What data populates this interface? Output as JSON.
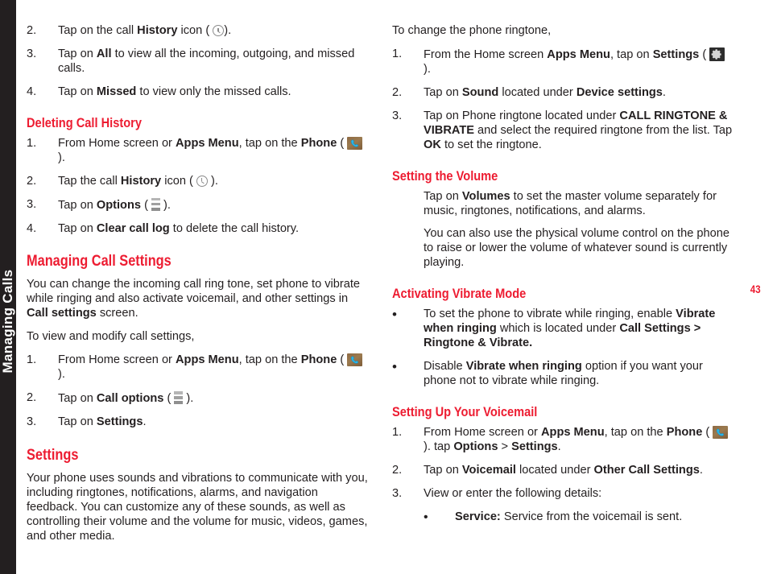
{
  "page": {
    "number": "43",
    "side_tab_label": "Managing Calls",
    "accent_color": "#ed1c31",
    "text_color": "#231f20",
    "tab_background": "#231f20"
  },
  "icons": {
    "clock": "clock-icon",
    "phone": "phone-icon",
    "options": "options-menu-icon",
    "gear": "settings-gear-icon"
  },
  "left_column": {
    "list_top": [
      {
        "num": "2.",
        "parts": [
          {
            "t": "Tap on the call "
          },
          {
            "t": "History",
            "b": true
          },
          {
            "t": " icon ( "
          },
          {
            "icon": "clock"
          },
          {
            "t": ")."
          }
        ]
      },
      {
        "num": "3.",
        "parts": [
          {
            "t": "Tap on "
          },
          {
            "t": "All",
            "b": true
          },
          {
            "t": " to view all the incoming, outgoing, and missed calls."
          }
        ]
      },
      {
        "num": "4.",
        "parts": [
          {
            "t": "Tap on "
          },
          {
            "t": "Missed",
            "b": true
          },
          {
            "t": " to view only the missed calls."
          }
        ]
      }
    ],
    "heading_deleting": "Deleting Call History",
    "list_deleting": [
      {
        "num": "1.",
        "parts": [
          {
            "t": "From Home screen or "
          },
          {
            "t": "Apps Menu",
            "b": true
          },
          {
            "t": ", tap on the "
          },
          {
            "t": "Phone",
            "b": true
          },
          {
            "t": " ( "
          },
          {
            "icon": "phone"
          },
          {
            "t": " )."
          }
        ]
      },
      {
        "num": "2.",
        "parts": [
          {
            "t": "Tap the call "
          },
          {
            "t": "History",
            "b": true
          },
          {
            "t": " icon (  "
          },
          {
            "icon": "clock"
          },
          {
            "t": "  )."
          }
        ]
      },
      {
        "num": "3.",
        "parts": [
          {
            "t": "Tap on "
          },
          {
            "t": "Options",
            "b": true
          },
          {
            "t": " ( "
          },
          {
            "icon": "options"
          },
          {
            "t": " )."
          }
        ]
      },
      {
        "num": "4.",
        "parts": [
          {
            "t": "Tap on "
          },
          {
            "t": "Clear call log",
            "b": true
          },
          {
            "t": " to delete the call history."
          }
        ]
      }
    ],
    "heading_managing": "Managing Call Settings",
    "para_managing": [
      {
        "t": "You can change the incoming call ring tone, set phone to vibrate while ringing and also activate voicemail, and other settings in "
      },
      {
        "t": "Call settings",
        "b": true
      },
      {
        "t": " screen."
      }
    ],
    "para_toview": [
      {
        "t": "To view and modify call settings,"
      }
    ],
    "list_toview": [
      {
        "num": "1.",
        "parts": [
          {
            "t": "From Home screen or "
          },
          {
            "t": "Apps Menu",
            "b": true
          },
          {
            "t": ", tap on the "
          },
          {
            "t": "Phone",
            "b": true
          },
          {
            "t": " ( "
          },
          {
            "icon": "phone"
          },
          {
            "t": " )."
          }
        ]
      },
      {
        "num": "2.",
        "parts": [
          {
            "t": "Tap on "
          },
          {
            "t": "Call options",
            "b": true
          },
          {
            "t": " ( "
          },
          {
            "icon": "options"
          },
          {
            "t": " )."
          }
        ]
      },
      {
        "num": "3.",
        "parts": [
          {
            "t": "Tap on "
          },
          {
            "t": "Settings",
            "b": true
          },
          {
            "t": "."
          }
        ]
      }
    ],
    "heading_settings": "Settings",
    "para_settings": [
      {
        "t": "Your phone uses sounds and vibrations to communicate with you, including ringtones, notifications, alarms, and navigation feedback. You can customize any of these sounds, as well as controlling their volume and the volume for music, videos, games, and other media."
      }
    ]
  },
  "right_column": {
    "para_ringtone": [
      {
        "t": "To change the phone ringtone,"
      }
    ],
    "list_ringtone": [
      {
        "num": "1.",
        "parts": [
          {
            "t": "From the Home screen "
          },
          {
            "t": "Apps Menu",
            "b": true
          },
          {
            "t": ", tap on "
          },
          {
            "t": "Settings",
            "b": true
          },
          {
            "t": " ( "
          },
          {
            "icon": "gear"
          },
          {
            "t": " )."
          }
        ]
      },
      {
        "num": "2.",
        "parts": [
          {
            "t": "Tap on "
          },
          {
            "t": "Sound",
            "b": true
          },
          {
            "t": " located under "
          },
          {
            "t": "Device settings",
            "b": true
          },
          {
            "t": "."
          }
        ]
      },
      {
        "num": "3.",
        "parts": [
          {
            "t": "Tap on Phone ringtone located under "
          },
          {
            "t": "CALL RINGTONE & VIBRATE",
            "b": true
          },
          {
            "t": " and select the required ringtone from the list. Tap "
          },
          {
            "t": "OK",
            "b": true
          },
          {
            "t": " to set the ringtone."
          }
        ]
      }
    ],
    "heading_volume": "Setting the Volume",
    "para_volume_1": [
      {
        "t": "Tap on "
      },
      {
        "t": "Volumes",
        "b": true
      },
      {
        "t": " to set the master volume separately for music, ringtones, notifications, and alarms."
      }
    ],
    "para_volume_2": [
      {
        "t": "You can also use the physical volume control on the phone to raise or lower the volume of whatever sound is currently playing."
      }
    ],
    "heading_vibrate": "Activating Vibrate Mode",
    "list_vibrate": [
      {
        "num": "•",
        "parts": [
          {
            "t": "To set the phone to vibrate while ringing, enable "
          },
          {
            "t": "Vibrate when ringing",
            "b": true
          },
          {
            "t": " which is located under "
          },
          {
            "t": "Call Settings > Ringtone & Vibrate.",
            "b": true
          }
        ]
      },
      {
        "num": "•",
        "parts": [
          {
            "t": "Disable "
          },
          {
            "t": "Vibrate when ringing",
            "b": true
          },
          {
            "t": " option if you want your phone not to vibrate while ringing."
          }
        ]
      }
    ],
    "heading_voicemail": "Setting Up Your Voicemail",
    "list_voicemail": [
      {
        "num": "1.",
        "parts": [
          {
            "t": "From Home screen or "
          },
          {
            "t": "Apps Menu",
            "b": true
          },
          {
            "t": ", tap on the "
          },
          {
            "t": "Phone",
            "b": true
          },
          {
            "t": " ( "
          },
          {
            "icon": "phone"
          },
          {
            "t": " ). tap "
          },
          {
            "t": "Options",
            "b": true
          },
          {
            "t": " > "
          },
          {
            "t": "Settings",
            "b": true
          },
          {
            "t": "."
          }
        ]
      },
      {
        "num": "2.",
        "parts": [
          {
            "t": "Tap on "
          },
          {
            "t": "Voicemail",
            "b": true
          },
          {
            "t": " located under "
          },
          {
            "t": "Other Call Settings",
            "b": true
          },
          {
            "t": "."
          }
        ]
      },
      {
        "num": "3.",
        "parts": [
          {
            "t": "View or enter the following details:"
          }
        ]
      }
    ],
    "sub_bullet_service": {
      "marker": "•",
      "parts": [
        {
          "t": "Service:",
          "b": true
        },
        {
          "t": " Service from the voicemail is sent."
        }
      ]
    }
  }
}
